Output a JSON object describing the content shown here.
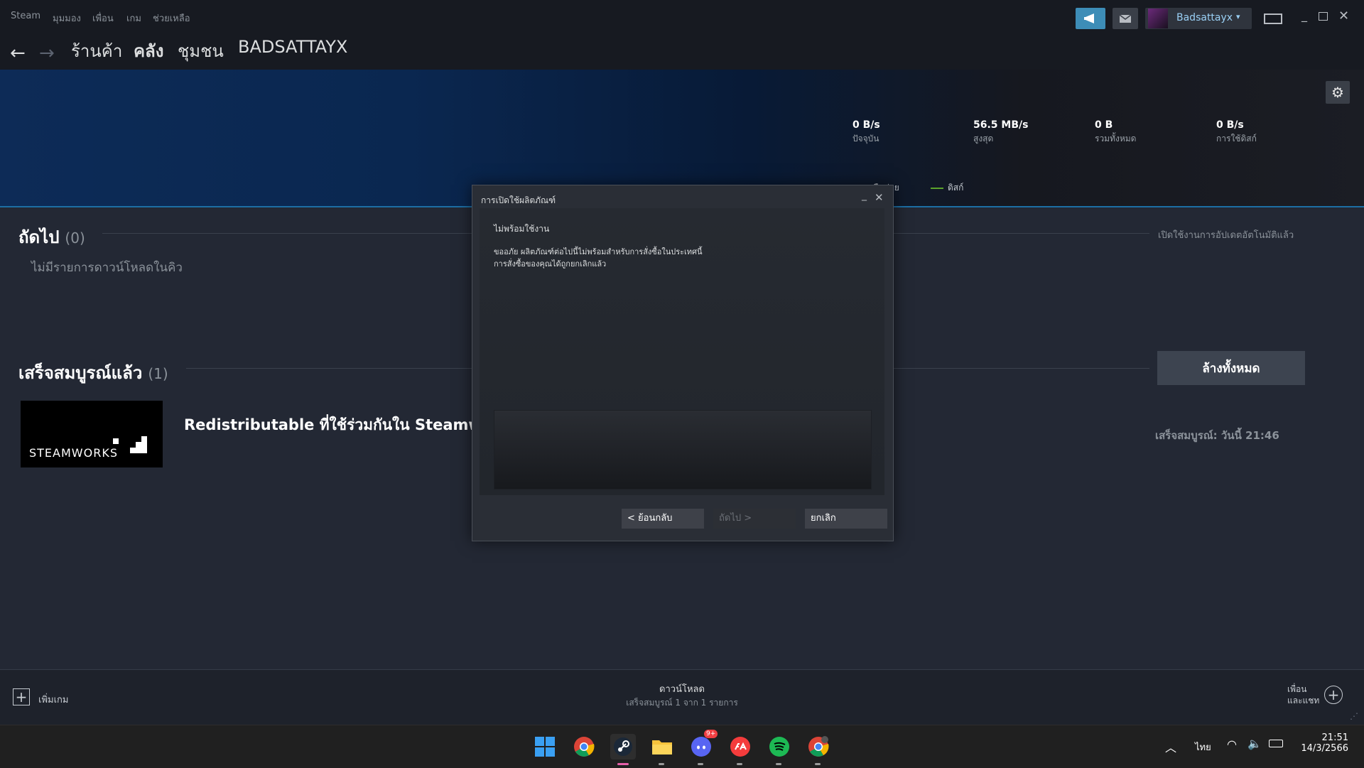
{
  "menu": {
    "app": "Steam",
    "items": [
      "มุมมอง",
      "เพื่อน",
      "เกม",
      "ช่วยเหลือ"
    ]
  },
  "account": {
    "username": "Badsattayx"
  },
  "nav": {
    "store": "ร้านค้า",
    "library": "คลัง",
    "community": "ชุมชน",
    "profile": "BADSATTAYX"
  },
  "stats": {
    "current": {
      "value": "0 B/s",
      "label": "ปัจจุบัน"
    },
    "peak": {
      "value": "56.5 MB/s",
      "label": "สูงสุด"
    },
    "total": {
      "value": "0 B",
      "label": "รวมทั้งหมด"
    },
    "disk": {
      "value": "0 B/s",
      "label": "การใช้ดิสก์"
    },
    "legend_network": "เครือข่าย",
    "legend_disk": "ดิสก์"
  },
  "queue": {
    "title": "ถัดไป",
    "count": "(0)",
    "empty": "ไม่มีรายการดาวน์โหลดในคิว",
    "auto_update": "เปิดใช้งานการอัปเดตอัตโนมัติแล้ว"
  },
  "completed": {
    "title": "เสร็จสมบูรณ์แล้ว",
    "count": "(1)",
    "clear_all": "ล้างทั้งหมด",
    "item_title": "Redistributable ที่ใช้ร่วมกันใน Steamworks",
    "item_logo": "STEAMWORKS",
    "item_status": "เสร็จสมบูรณ์: วันนี้ 21:46"
  },
  "footer": {
    "add_game": "เพิ่มเกม",
    "downloads_title": "ดาวน์โหลด",
    "downloads_sub": "เสร็จสมบูรณ์ 1 จาก 1 รายการ",
    "friends_line1": "เพื่อน",
    "friends_line2": "และแชท"
  },
  "dialog": {
    "title": "การเปิดใช้ผลิตภัณฑ์",
    "heading": "ไม่พร้อมใช้งาน",
    "line1": "ขออภัย ผลิตภัณฑ์ต่อไปนี้ไม่พร้อมสำหรับการสั่งซื้อในประเทศนี้",
    "line2": "การสั่งซื้อของคุณได้ถูกยกเลิกแล้ว",
    "back": "< ย้อนกลับ",
    "next": "ถัดไป >",
    "cancel": "ยกเลิก"
  },
  "taskbar": {
    "lang": "ไทย",
    "time": "21:51",
    "date": "14/3/2566",
    "discord_badge": "9+"
  },
  "colors": {
    "accent": "#1a9fff",
    "disk_green": "#5ba32b",
    "bg": "#232834"
  }
}
